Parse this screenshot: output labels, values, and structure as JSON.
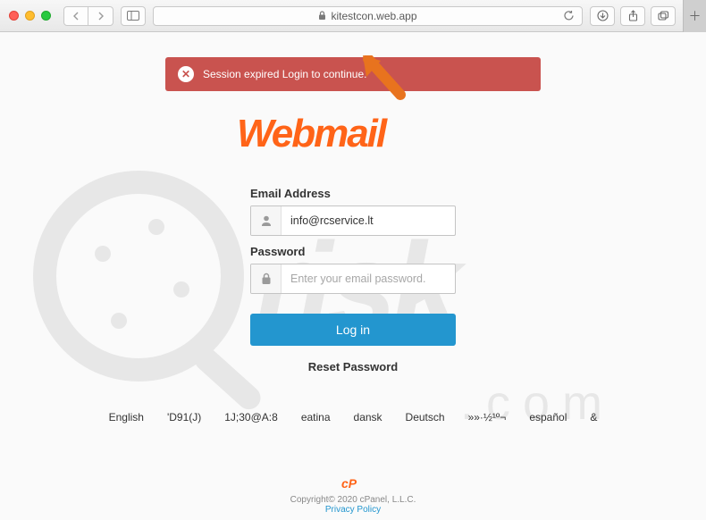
{
  "browser": {
    "url": "kitestcon.web.app"
  },
  "alert": {
    "message": "Session expired Login to continue."
  },
  "logo_text": "Webmail",
  "form": {
    "email_label": "Email Address",
    "email_value": "info@rcservice.lt",
    "password_label": "Password",
    "password_placeholder": "Enter your email password.",
    "login_button": "Log in",
    "reset_link": "Reset Password"
  },
  "languages": [
    "English",
    "'D91(J)",
    "1J;30@A:8",
    "eatina",
    "dansk",
    "Deutsch",
    "»»·½¹º¬",
    "español",
    "&"
  ],
  "footer": {
    "copyright": "Copyright© 2020 cPanel, L.L.C.",
    "privacy": "Privacy Policy",
    "brand": "cP"
  }
}
